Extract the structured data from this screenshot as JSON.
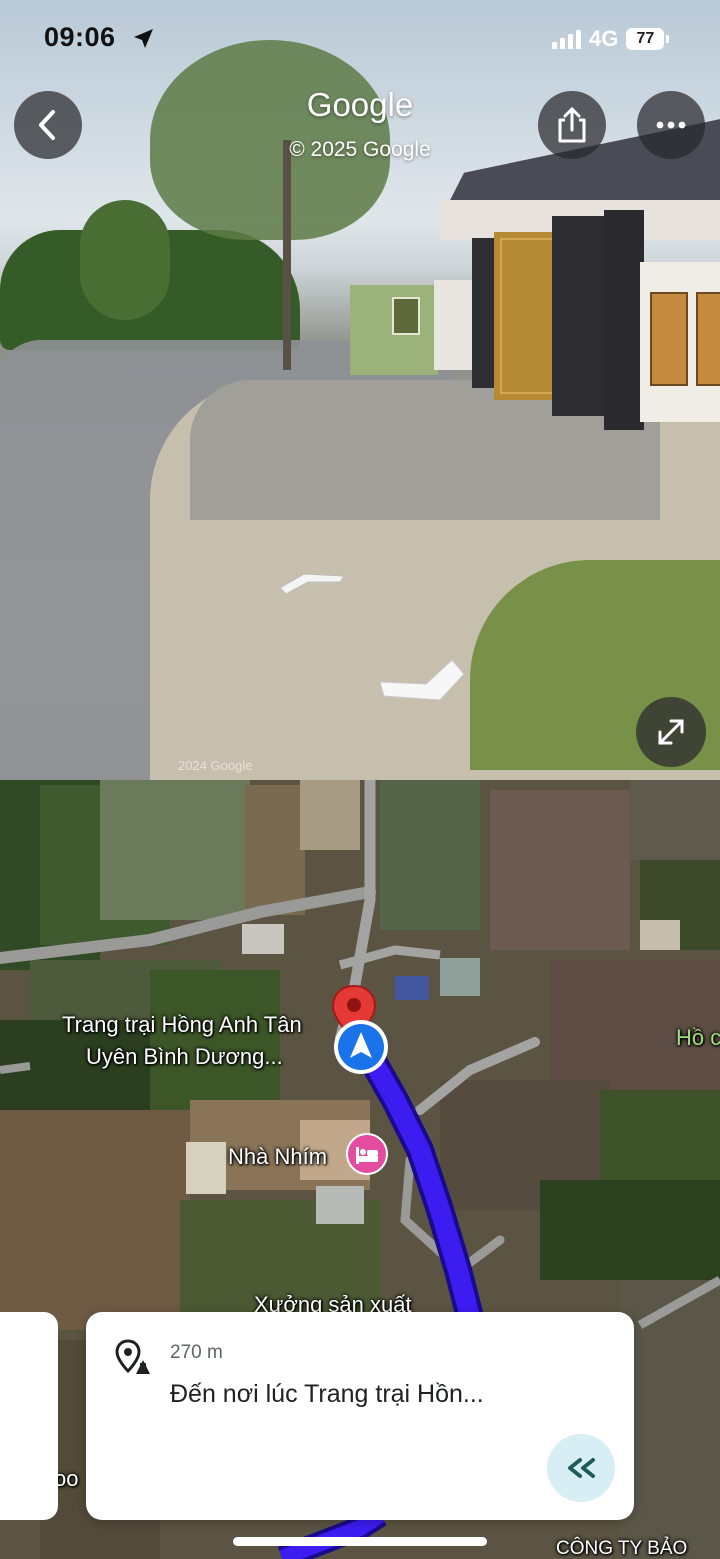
{
  "status_bar": {
    "time": "09:06",
    "network": "4G",
    "battery": "77"
  },
  "street_view": {
    "title": "Google",
    "copyright": "© 2025 Google",
    "watermark": "2024 Google"
  },
  "map": {
    "labels": {
      "place_line1": "Trang trại Hồng Anh Tân",
      "place_line2": "Uyên Bình Dương...",
      "poi_lodging": "Nhà Nhím",
      "poi_factory": "Xưởng sản xuất",
      "edge_right": "Hồ c",
      "company": "CÔNG TY BẢO",
      "edge_left": "oo"
    },
    "colors": {
      "route": "#3d1cf2",
      "route_outline": "#1a0b8c",
      "pin": "#e53935",
      "location": "#1a73e8"
    }
  },
  "navigation": {
    "distance": "270 m",
    "instruction": "Đến nơi lúc Trang trại Hồn..."
  },
  "icons": [
    "back-icon",
    "share-icon",
    "more-icon",
    "expand-icon",
    "destination-icon",
    "replay-icon",
    "lodging-icon",
    "location-arrow-icon",
    "pin-icon"
  ]
}
